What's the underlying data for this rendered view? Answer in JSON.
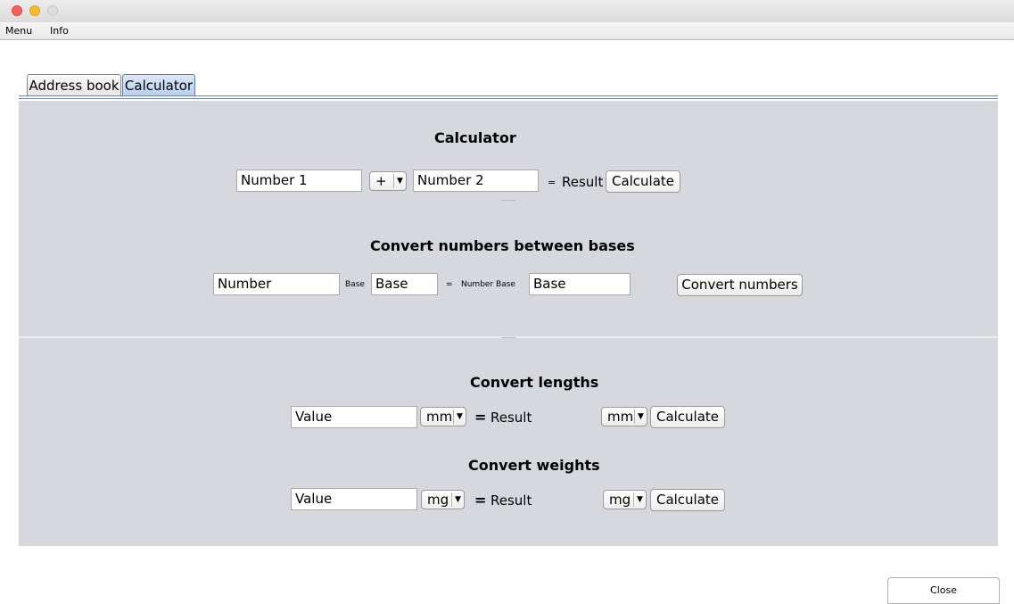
{
  "window": {
    "colors": {
      "close": "#fc5f57",
      "minimize": "#fdbc2e",
      "zoom": "#dcdcdc"
    }
  },
  "menu": {
    "items": [
      "Menu",
      "Info"
    ]
  },
  "tabs": [
    {
      "label": "Address book"
    },
    {
      "label": "Calculator",
      "selected": true
    }
  ],
  "calculator": {
    "heading": "Calculator",
    "number1": "Number 1",
    "operator": "+",
    "number2": "Number 2",
    "equals": "=",
    "result": "Result",
    "calculate": "Calculate"
  },
  "bases": {
    "heading": "Convert numbers between bases",
    "number": "Number",
    "base_label": "Base",
    "base_value": "Base",
    "equals": "=",
    "number_base_label": "Number Base",
    "target_base_value": "Base",
    "convert": "Convert numbers"
  },
  "lengths": {
    "heading": "Convert lengths",
    "value": "Value",
    "from_unit": "mm",
    "equals": "=",
    "result": "Result",
    "to_unit": "mm",
    "calculate": "Calculate"
  },
  "weights": {
    "heading": "Convert weights",
    "value": "Value",
    "from_unit": "mg",
    "equals": "=",
    "result": "Result",
    "to_unit": "mg",
    "calculate": "Calculate"
  },
  "footer": {
    "close": "Close"
  },
  "icons": {
    "dropdown": "chevron-down-icon"
  }
}
